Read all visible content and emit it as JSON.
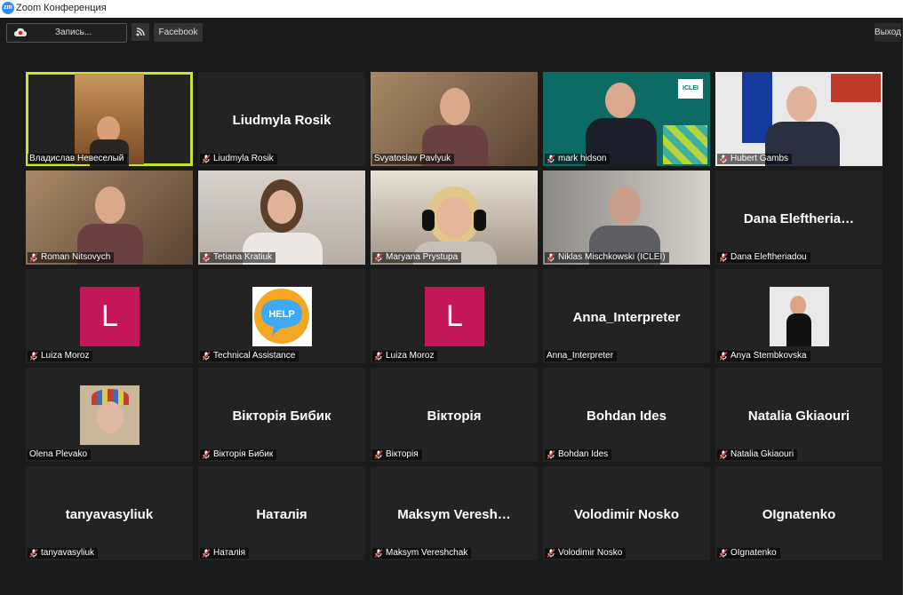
{
  "window": {
    "title": "Zoom Конференция",
    "logo_text": "zm"
  },
  "toolbar": {
    "record_label": "Запись...",
    "facebook_label": "Facebook",
    "exit_label": "Выход"
  },
  "colors": {
    "active_speaker_border": "#c4e33f",
    "avatar_L": "#c4185b",
    "tile_bg": "#232323",
    "window_bg": "#1a1a1a"
  },
  "participants": [
    {
      "name": "Владислав Невеселый",
      "big": "",
      "muted": false,
      "kind": "video-office",
      "active": true
    },
    {
      "name": "Liudmyla Rosik",
      "big": "Liudmyla Rosik",
      "muted": true,
      "kind": "name"
    },
    {
      "name": "Svyatoslav Pavlyuk",
      "big": "",
      "muted": false,
      "kind": "video-man"
    },
    {
      "name": "mark hidson",
      "big": "",
      "muted": true,
      "kind": "video-iclei"
    },
    {
      "name": "Hubert Gambs",
      "big": "",
      "muted": true,
      "kind": "video-eu"
    },
    {
      "name": "Roman Nitsovych",
      "big": "",
      "muted": true,
      "kind": "video-man"
    },
    {
      "name": "Tetiana Kratiuk",
      "big": "",
      "muted": true,
      "kind": "video-woman"
    },
    {
      "name": "Maryana Prystupa",
      "big": "",
      "muted": true,
      "kind": "video-headphones"
    },
    {
      "name": "Niklas Mischkowski (ICLEI)",
      "big": "",
      "muted": true,
      "kind": "video-man2"
    },
    {
      "name": "Dana Eleftheriadou",
      "big": "Dana  Eleftheria…",
      "muted": true,
      "kind": "name"
    },
    {
      "name": "Luiza Moroz",
      "big": "L",
      "muted": true,
      "kind": "avatar-L"
    },
    {
      "name": "Technical Assistance",
      "big": "HELP",
      "muted": true,
      "kind": "help"
    },
    {
      "name": "Luiza Moroz",
      "big": "L",
      "muted": true,
      "kind": "avatar-L"
    },
    {
      "name": "Anna_Interpreter",
      "big": "Anna_Interpreter",
      "muted": false,
      "kind": "name"
    },
    {
      "name": "Anya Stembkovska",
      "big": "",
      "muted": true,
      "kind": "photo-woman"
    },
    {
      "name": "Olena Plevako",
      "big": "",
      "muted": false,
      "kind": "photo-painting"
    },
    {
      "name": "Вікторія Бибик",
      "big": "Вікторія Бибик",
      "muted": true,
      "kind": "name"
    },
    {
      "name": "Вікторія",
      "big": "Вікторія",
      "muted": true,
      "kind": "name"
    },
    {
      "name": "Bohdan Ides",
      "big": "Bohdan Ides",
      "muted": true,
      "kind": "name"
    },
    {
      "name": "Natalia Gkiaouri",
      "big": "Natalia Gkiaouri",
      "muted": true,
      "kind": "name"
    },
    {
      "name": "tanyavasyliuk",
      "big": "tanyavasyliuk",
      "muted": true,
      "kind": "name"
    },
    {
      "name": "Наталія",
      "big": "Наталія",
      "muted": true,
      "kind": "name"
    },
    {
      "name": "Maksym Vereshchak",
      "big": "Maksym  Veresh…",
      "muted": true,
      "kind": "name"
    },
    {
      "name": "Volodimir Nosko",
      "big": "Volodimir Nosko",
      "muted": true,
      "kind": "name"
    },
    {
      "name": "OIgnatenko",
      "big": "OIgnatenko",
      "muted": true,
      "kind": "name"
    }
  ]
}
